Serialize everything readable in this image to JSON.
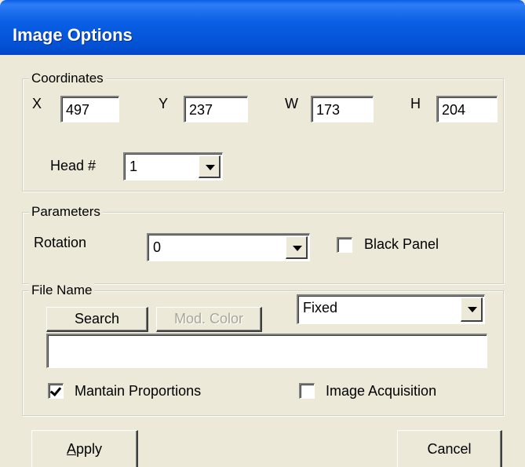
{
  "window": {
    "title": "Image Options"
  },
  "coordinates": {
    "legend": "Coordinates",
    "x_label": "X",
    "x_value": "497",
    "y_label": "Y",
    "y_value": "237",
    "w_label": "W",
    "w_value": "173",
    "h_label": "H",
    "h_value": "204",
    "head_label": "Head #",
    "head_value": "1"
  },
  "parameters": {
    "legend": "Parameters",
    "rotation_label": "Rotation",
    "rotation_value": "0",
    "black_panel_label": "Black Panel",
    "black_panel_checked": false
  },
  "file_name": {
    "legend": "File Name",
    "search_label": "Search",
    "mod_color_label": "Mod. Color",
    "mode_value": "Fixed",
    "path_value": "",
    "maintain_label": "Mantain Proportions",
    "maintain_checked": true,
    "acquisition_label": "Image Acquisition",
    "acquisition_checked": false
  },
  "buttons": {
    "apply_first": "A",
    "apply_rest": "pply",
    "cancel": "Cancel"
  }
}
